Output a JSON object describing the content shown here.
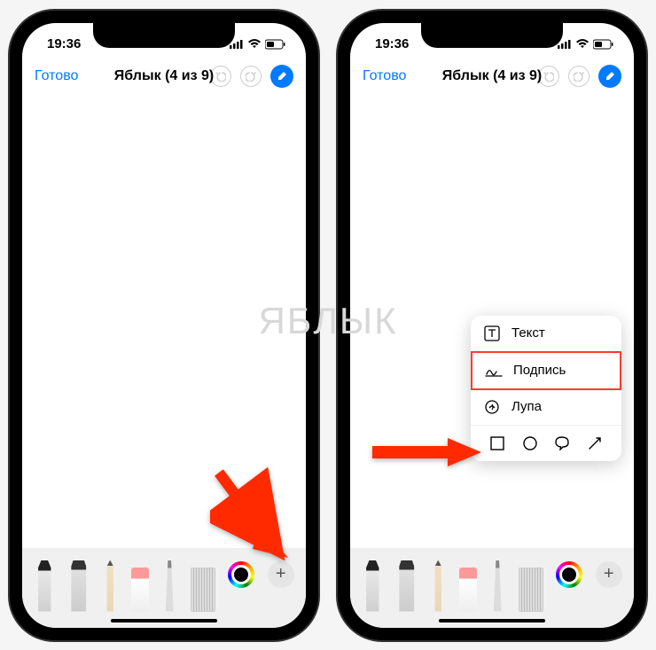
{
  "status": {
    "time": "19:36"
  },
  "nav": {
    "done": "Готово",
    "title": "Яблык (4 из 9)"
  },
  "popup": {
    "text": "Текст",
    "signature": "Подпись",
    "magnifier": "Лупа"
  },
  "watermark": "ЯБЛЫК",
  "icons": {
    "plus": "+"
  }
}
